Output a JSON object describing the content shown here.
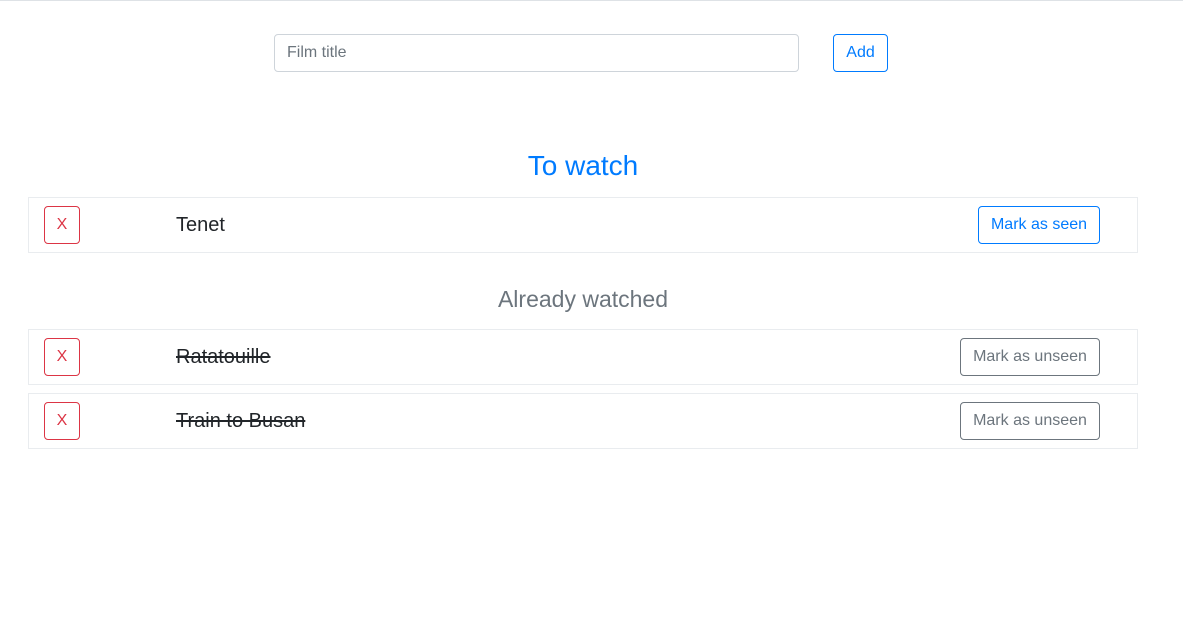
{
  "form": {
    "title_placeholder": "Film title",
    "add_label": "Add"
  },
  "to_watch": {
    "heading": "To watch",
    "films": [
      {
        "delete_label": "X",
        "title": "Tenet",
        "action_label": "Mark as seen"
      }
    ]
  },
  "watched": {
    "heading": "Already watched",
    "films": [
      {
        "delete_label": "X",
        "title": "Ratatouille",
        "action_label": "Mark as unseen"
      },
      {
        "delete_label": "X",
        "title": "Train to Busan",
        "action_label": "Mark as unseen"
      }
    ]
  },
  "colors": {
    "primary": "#007bff",
    "danger": "#dc3545",
    "secondary": "#6c757d"
  }
}
